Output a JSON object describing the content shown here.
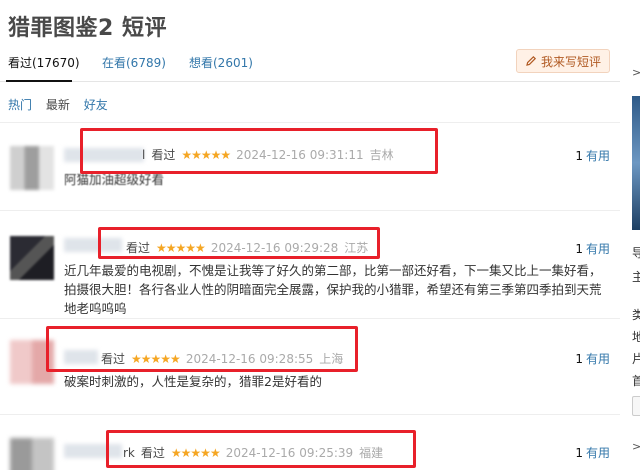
{
  "page": {
    "title": "猎罪图鉴2 短评"
  },
  "tabs": [
    {
      "label": "看过(17670)"
    },
    {
      "label": "在看(6789)"
    },
    {
      "label": "想看(2601)"
    }
  ],
  "write_button": {
    "label": "我来写短评",
    "icon": "pencil-icon"
  },
  "sort": {
    "hot": "热门",
    "newest": "最新",
    "friends": "好友"
  },
  "comments": [
    {
      "name_suffix": "l",
      "status": "看过",
      "stars": "★★★★★",
      "time": "2024-12-16 09:31:11",
      "location": "吉林",
      "useful_count": "1",
      "useful_label": "有用",
      "text": "阿猫加油超级好看"
    },
    {
      "name_suffix": "",
      "status": "看过",
      "stars": "★★★★★",
      "time": "2024-12-16 09:29:28",
      "location": "江苏",
      "useful_count": "1",
      "useful_label": "有用",
      "text": "近几年最爱的电视剧，不愧是让我等了好久的第二部，比第一部还好看，下一集又比上一集好看，拍摄很大胆！各行各业人性的阴暗面完全展露，保护我的小猎罪，希望还有第三季第四季拍到天荒地老呜呜呜"
    },
    {
      "name_suffix": "",
      "status": "看过",
      "stars": "★★★★★",
      "time": "2024-12-16 09:28:55",
      "location": "上海",
      "useful_count": "1",
      "useful_label": "有用",
      "text": "破案时刺激的，人性是复杂的，猎罪2是好看的"
    },
    {
      "name_suffix": "rk",
      "status": "看过",
      "stars": "★★★★★",
      "time": "2024-12-16 09:25:39",
      "location": "福建",
      "useful_count": "1",
      "useful_label": "有用",
      "text": ""
    }
  ],
  "sidebar_partial": {
    "arrow1": ">",
    "arrow2": ">",
    "chars": [
      "导",
      "主",
      "类",
      "地",
      "片",
      "首"
    ]
  },
  "colors": {
    "link": "#3377aa",
    "star": "#f5a623",
    "highlight": "#e8202a"
  }
}
